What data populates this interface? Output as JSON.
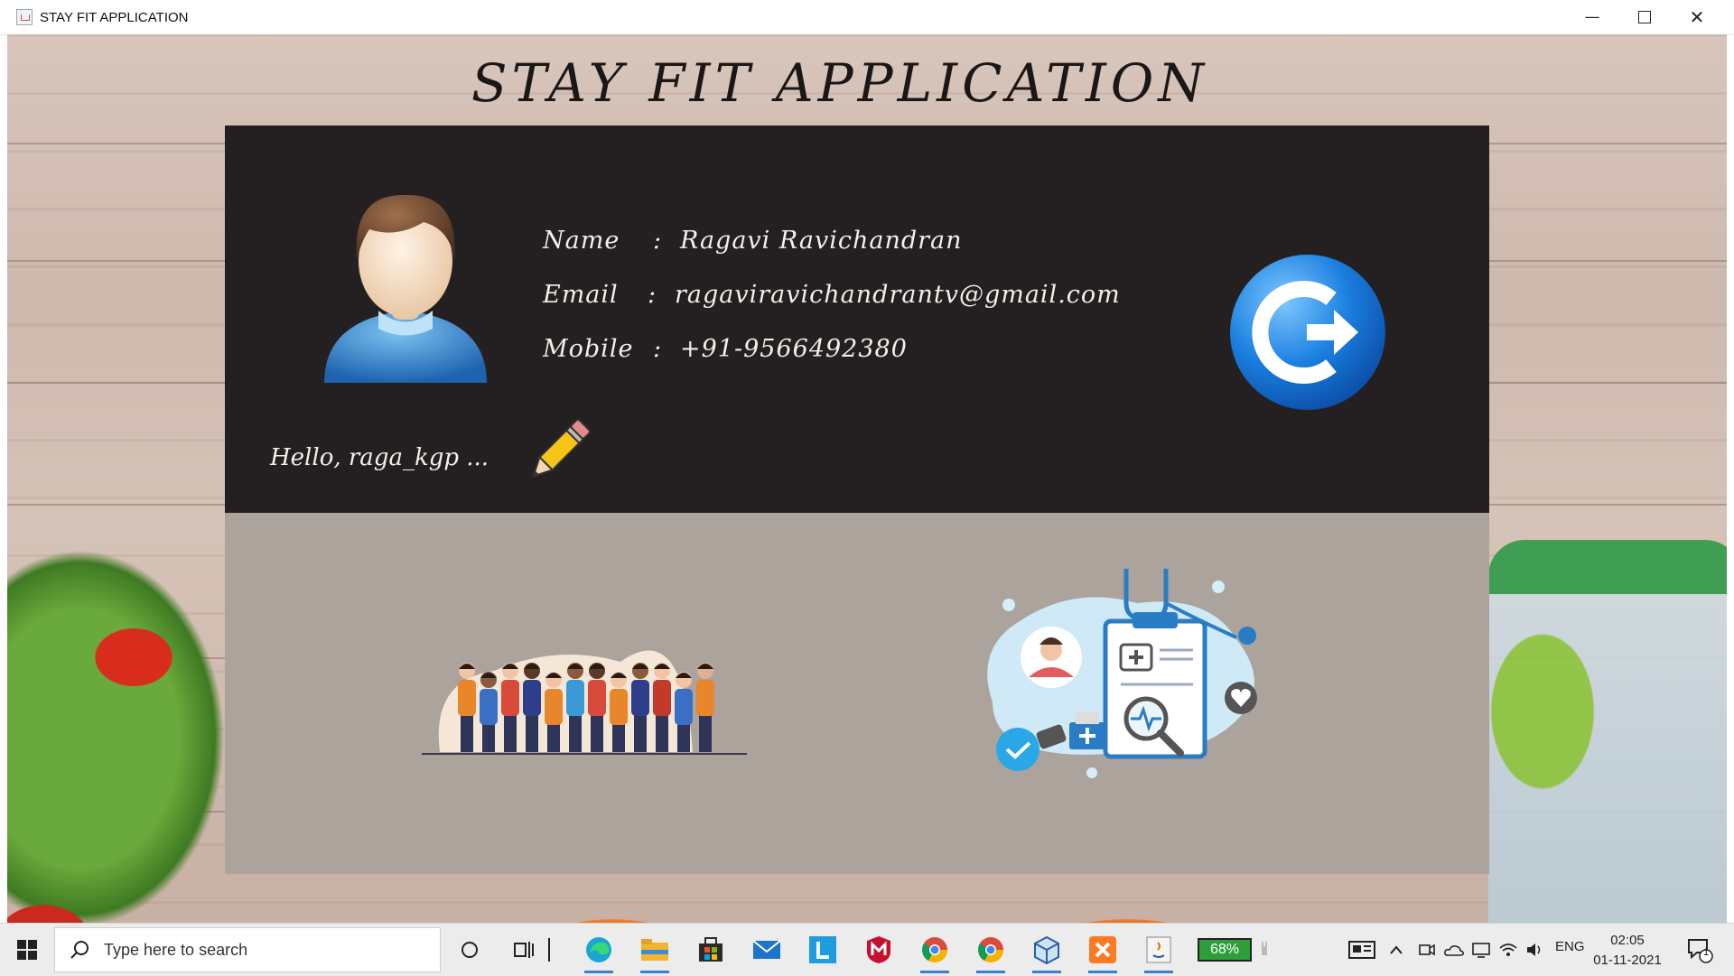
{
  "window": {
    "title": "STAY FIT APPLICATION",
    "controls": {
      "minimize": "—",
      "close": "✕"
    }
  },
  "app": {
    "heading": "STAY FIT APPLICATION"
  },
  "profile": {
    "name_label": "Name",
    "name_sep": ":",
    "name_value": "Ragavi Ravichandran",
    "email_label": "Email",
    "email_sep": ":",
    "email_value": "ragaviravichandrantv@gmail.com",
    "mobile_label": "Mobile",
    "mobile_sep": ":",
    "mobile_value": "+91-9566492380",
    "greeting": "Hello, raga_kgp ..."
  },
  "icons": {
    "avatar": "user-avatar-icon",
    "edit": "pencil-icon",
    "logout": "logout-icon",
    "community": "people-group-icon",
    "health": "medical-checkup-icon"
  },
  "taskbar": {
    "search_placeholder": "Type here to search",
    "battery": "68%",
    "language": "ENG",
    "time": "02:05",
    "date": "01-11-2021",
    "notification_count": "1"
  },
  "colors": {
    "profile_panel": "#241f20",
    "nav_panel": "#aba39c",
    "text_light": "#f3f0ea",
    "logout_blue": "#1a7fe0"
  }
}
